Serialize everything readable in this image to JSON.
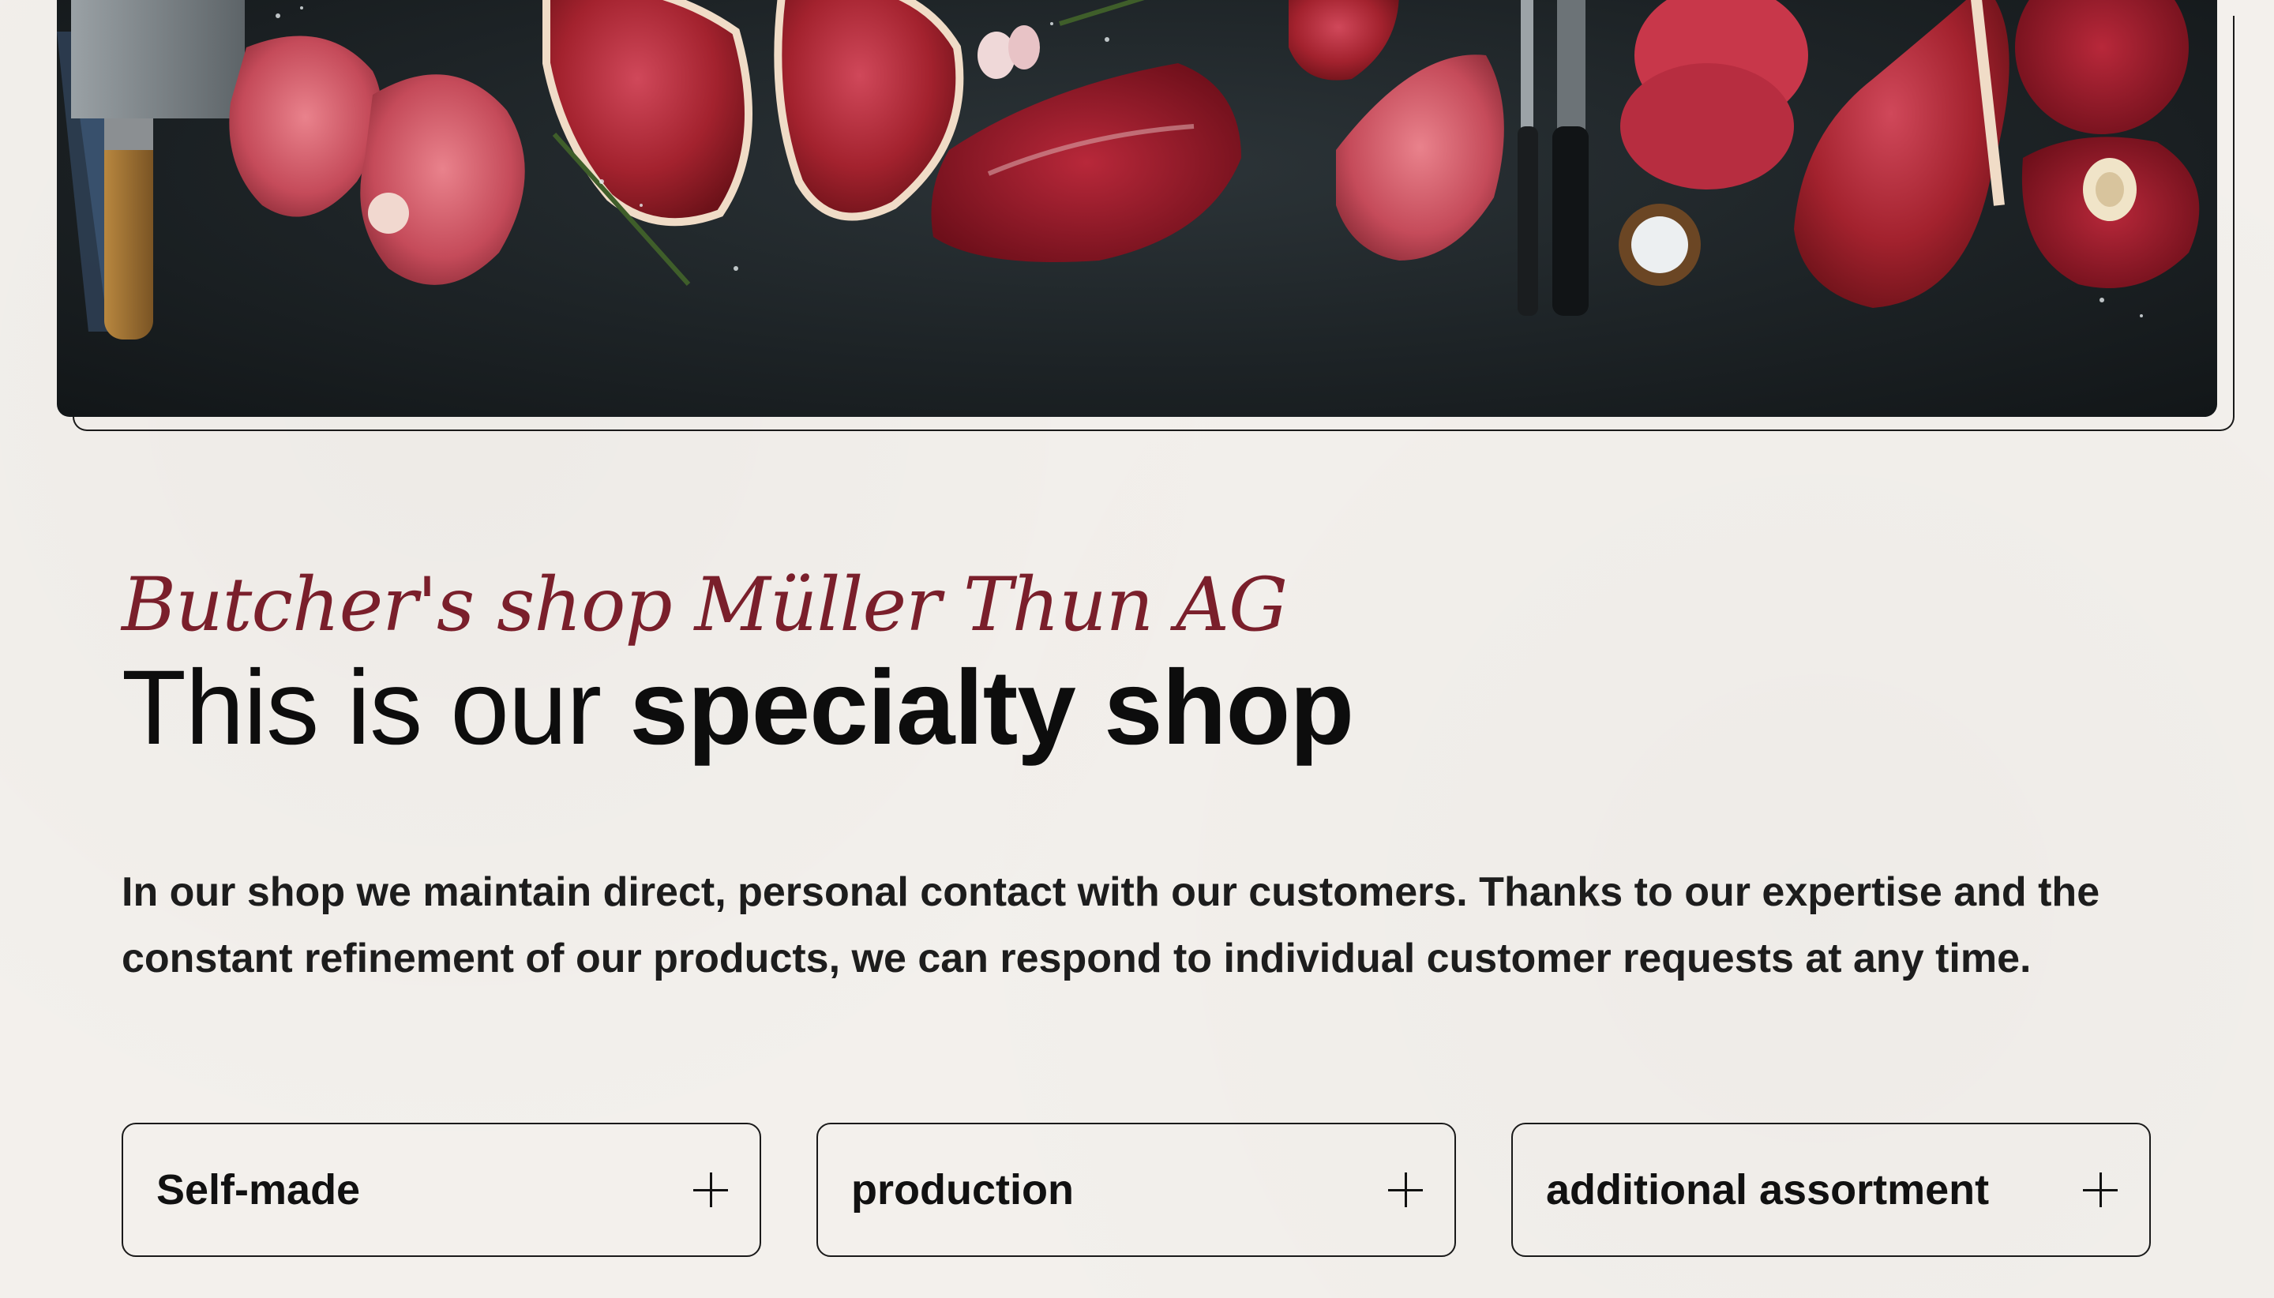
{
  "hero": {
    "alt": "Assortment of raw meat cuts on a dark slate surface"
  },
  "intro_section": {
    "eyebrow": "Butcher's shop Müller Thun AG",
    "headline_light": "This is our ",
    "headline_bold": "specialty shop",
    "paragraph": "In our shop we maintain direct, personal contact with our customers. Thanks to our expertise and the constant refinement of our products, we can respond to individual customer requests at any time."
  },
  "accordions": [
    {
      "label": "Self-made",
      "icon": "plus-icon"
    },
    {
      "label": "production",
      "icon": "plus-icon"
    },
    {
      "label": "additional assortment",
      "icon": "plus-icon"
    }
  ],
  "colors": {
    "background": "#f3f0ec",
    "accent": "#7a1f2b",
    "text": "#111111"
  }
}
